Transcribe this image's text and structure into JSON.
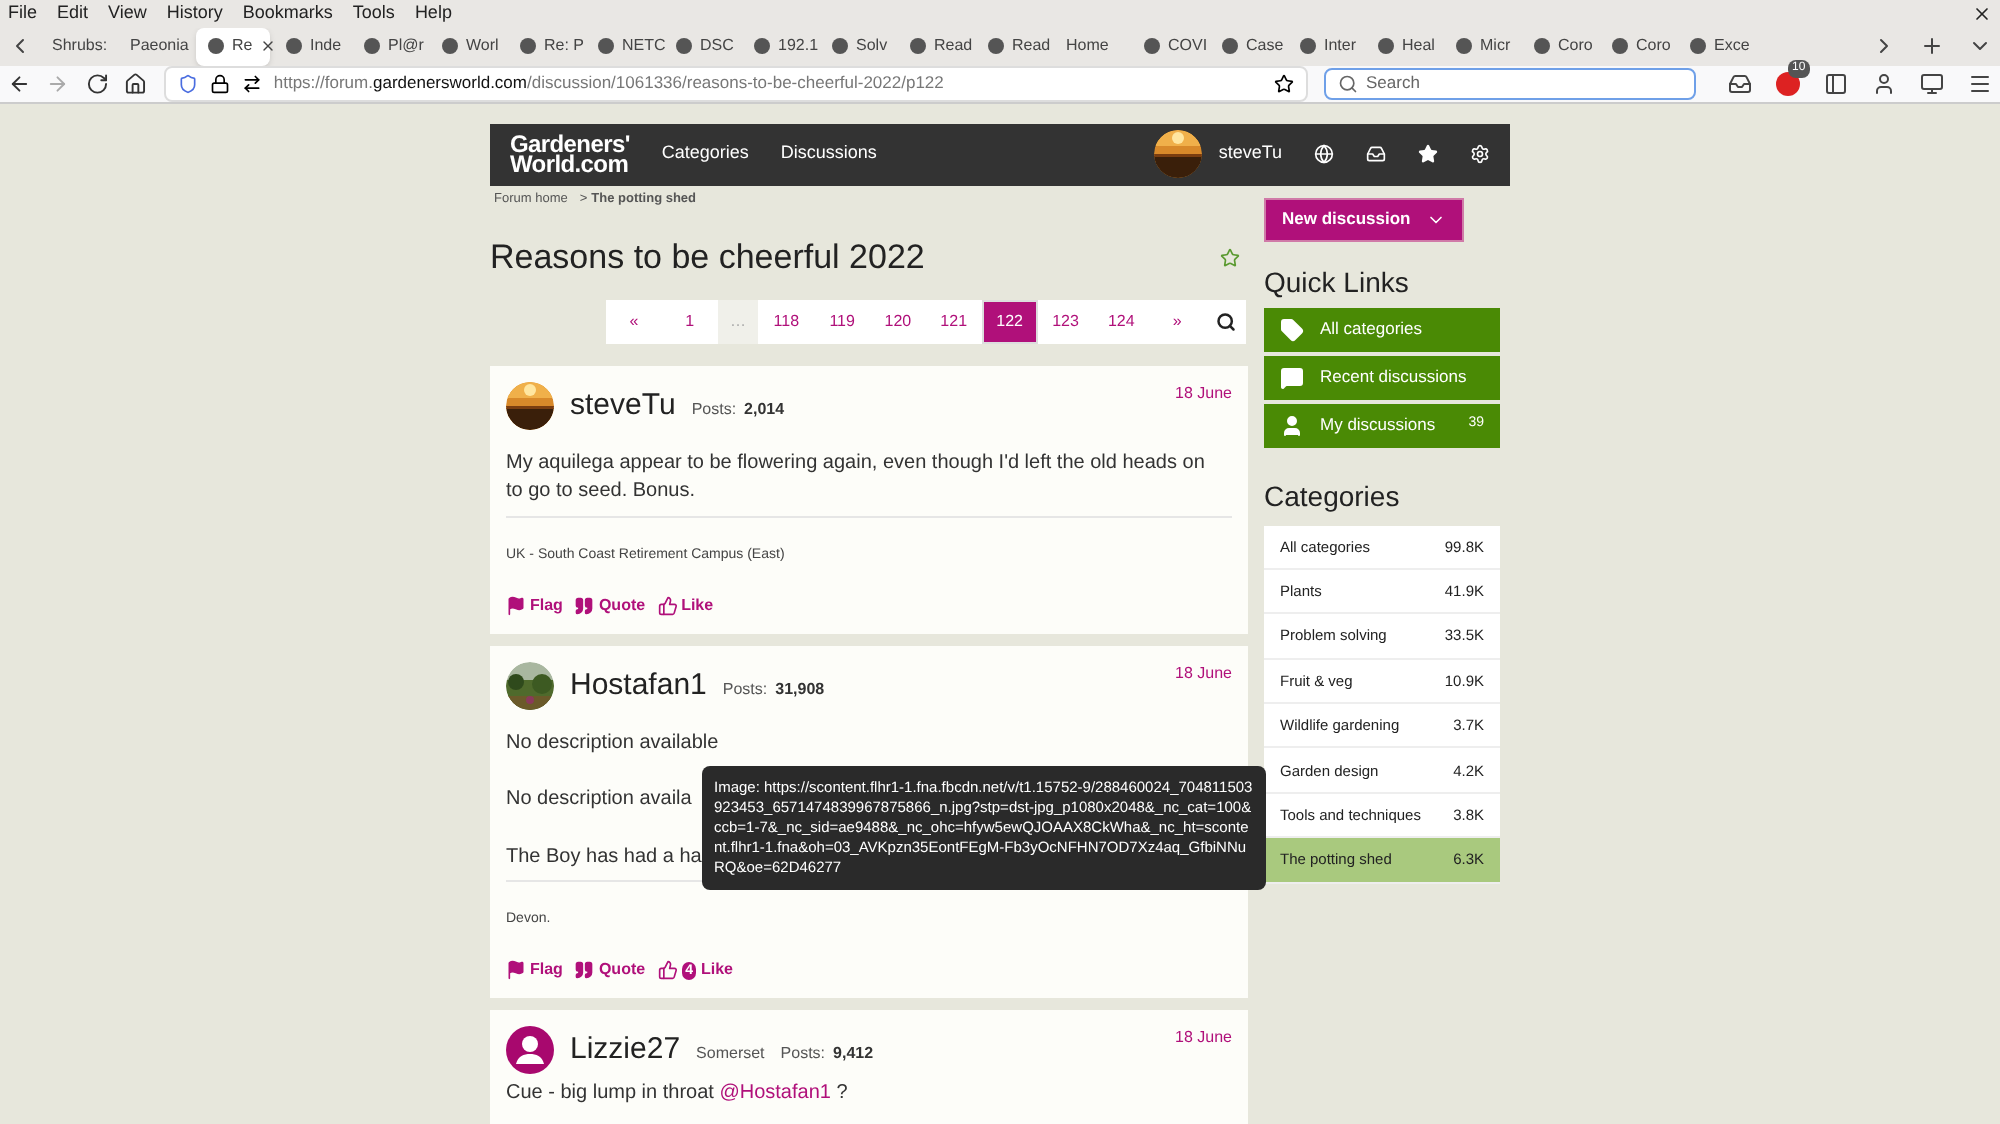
{
  "menu_bar": [
    "File",
    "Edit",
    "View",
    "History",
    "Bookmarks",
    "Tools",
    "Help"
  ],
  "tabs": [
    {
      "label": "Shrubs:",
      "kind": "plain",
      "selected": false
    },
    {
      "label": "Paeonia",
      "kind": "plain",
      "selected": false
    },
    {
      "label": "Re",
      "kind": "icon",
      "selected": true
    },
    {
      "label": "Inde",
      "kind": "icon",
      "selected": false
    },
    {
      "label": "Pl@r",
      "kind": "icon",
      "selected": false
    },
    {
      "label": "Worl",
      "kind": "icon",
      "selected": false
    },
    {
      "label": "Re: P",
      "kind": "icon",
      "selected": false
    },
    {
      "label": "NETC",
      "kind": "icon",
      "selected": false
    },
    {
      "label": "DSC",
      "kind": "icon",
      "selected": false
    },
    {
      "label": "192.1",
      "kind": "icon",
      "selected": false
    },
    {
      "label": "Solv",
      "kind": "icon",
      "selected": false
    },
    {
      "label": "Read",
      "kind": "icon",
      "selected": false
    },
    {
      "label": "Read",
      "kind": "icon",
      "selected": false
    },
    {
      "label": "Home",
      "kind": "plain",
      "selected": false
    },
    {
      "label": "COVI",
      "kind": "icon",
      "selected": false
    },
    {
      "label": "Case",
      "kind": "icon",
      "selected": false
    },
    {
      "label": "Inter",
      "kind": "icon",
      "selected": false
    },
    {
      "label": "Heal",
      "kind": "icon",
      "selected": false
    },
    {
      "label": "Micr",
      "kind": "icon",
      "selected": false
    },
    {
      "label": "Coro",
      "kind": "icon",
      "selected": false
    },
    {
      "label": "Coro",
      "kind": "icon",
      "selected": false
    },
    {
      "label": "Exce",
      "kind": "icon",
      "selected": false
    }
  ],
  "address_bar": {
    "url_prefix": "https://forum.",
    "url_domain": "gardenersworld.com",
    "url_path": "/discussion/1061336/reasons-to-be-cheerful-2022/p122"
  },
  "search": {
    "placeholder": "Search"
  },
  "toolbar_badge": "10",
  "site_header": {
    "logo_line1": "Gardeners'",
    "logo_line2": "World.com",
    "nav": [
      "Categories",
      "Discussions"
    ],
    "user": "steveTu"
  },
  "breadcrumb": {
    "home": "Forum home",
    "separator": ">",
    "current": "The potting shed"
  },
  "thread_title": "Reasons to be cheerful 2022",
  "pagination": [
    {
      "label": "«",
      "kind": "link",
      "selected": false
    },
    {
      "label": "1",
      "kind": "link",
      "selected": false
    },
    {
      "label": "…",
      "kind": "gap",
      "selected": false
    },
    {
      "label": "118",
      "kind": "link",
      "selected": false
    },
    {
      "label": "119",
      "kind": "link",
      "selected": false
    },
    {
      "label": "120",
      "kind": "link",
      "selected": false
    },
    {
      "label": "121",
      "kind": "link",
      "selected": false
    },
    {
      "label": "122",
      "kind": "link",
      "selected": true
    },
    {
      "label": "123",
      "kind": "link",
      "selected": false
    },
    {
      "label": "124",
      "kind": "link",
      "selected": false
    },
    {
      "label": "»",
      "kind": "link",
      "selected": false
    }
  ],
  "posts": [
    {
      "author": "steveTu",
      "avatar": {
        "kind": "sunset"
      },
      "posts_label": "Posts:",
      "posts_count": "2,014",
      "date": "18 June",
      "paragraphs": [
        {
          "text": "My aquilega appear to be flowering again, even though I'd left the old heads on to go to seed. Bonus."
        }
      ],
      "signature": "UK - South Coast Retirement Campus (East)",
      "actions": {
        "flag": "Flag",
        "quote": "Quote",
        "like": "Like"
      }
    },
    {
      "author": "Hostafan1",
      "avatar": {
        "kind": "landscape"
      },
      "posts_label": "Posts:",
      "posts_count": "31,908",
      "date": "18 June",
      "paragraphs": [
        {
          "text": "No description available"
        },
        {
          "text": "No description availa"
        },
        {
          "text": "The Boy has had a ha"
        }
      ],
      "signature": "Devon.",
      "likes": "4",
      "actions": {
        "flag": "Flag",
        "quote": "Quote",
        "like": "Like"
      }
    },
    {
      "author": "Lizzie27",
      "avatar": {
        "kind": "generic"
      },
      "location": "Somerset",
      "posts_label": "Posts:",
      "posts_count": "9,412",
      "date": "18 June",
      "paragraphs": [
        {
          "text": "Cue - big lump in throat ",
          "mention": "@Hostafan1",
          "after": " ?"
        }
      ]
    }
  ],
  "tooltip": "Image: https://scontent.flhr1-1.fna.fbcdn.net/v/t1.15752-9/288460024_704811503923453_6571474839967875866_n.jpg?stp=dst-jpg_p1080x2048&_nc_cat=100&ccb=1-7&_nc_sid=ae9488&_nc_ohc=hfyw5ewQJOAAX8CkWha&_nc_ht=scontent.flhr1-1.fna&oh=03_AVKpzn35EontFEgM-Fb3yOcNFHN7OD7Xz4aq_GfbiNNuRQ&oe=62D46277",
  "new_discussion": "New discussion",
  "quick_links": {
    "title": "Quick Links",
    "items": [
      {
        "label": "All categories",
        "kind": "tag"
      },
      {
        "label": "Recent discussions",
        "kind": "chat"
      },
      {
        "label": "My discussions",
        "kind": "user",
        "count": "39"
      }
    ]
  },
  "categories": {
    "title": "Categories",
    "items": [
      {
        "label": "All categories",
        "count": "99.8K",
        "selected": false
      },
      {
        "label": "Plants",
        "count": "41.9K",
        "selected": false
      },
      {
        "label": "Problem solving",
        "count": "33.5K",
        "selected": false
      },
      {
        "label": "Fruit & veg",
        "count": "10.9K",
        "selected": false
      },
      {
        "label": "Wildlife gardening",
        "count": "3.7K",
        "selected": false
      },
      {
        "label": "Garden design",
        "count": "4.2K",
        "selected": false
      },
      {
        "label": "Tools and techniques",
        "count": "3.8K",
        "selected": false
      },
      {
        "label": "The potting shed",
        "count": "6.3K",
        "selected": true
      }
    ]
  }
}
